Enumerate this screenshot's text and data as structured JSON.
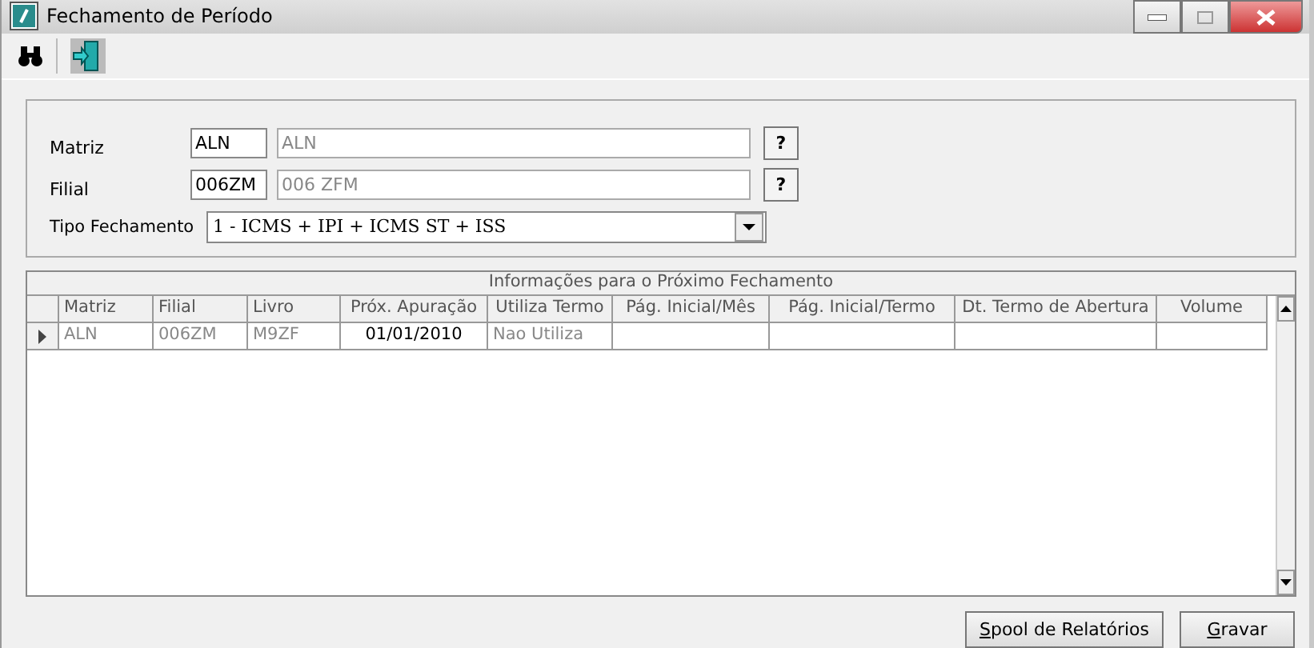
{
  "window": {
    "title": "Fechamento de Período"
  },
  "filters": {
    "matriz": {
      "label": "Matriz",
      "code": "ALN",
      "description": "ALN",
      "lookup": "?"
    },
    "filial": {
      "label": "Filial",
      "code": "006ZM",
      "description": "006 ZFM",
      "lookup": "?"
    },
    "tipo": {
      "label": "Tipo Fechamento",
      "value": "1  -  ICMS + IPI + ICMS ST + ISS"
    }
  },
  "table": {
    "title": "Informações para o Próximo Fechamento",
    "columns": [
      "Matriz",
      "Filial",
      "Livro",
      "Próx. Apuração",
      "Utiliza Termo",
      "Pág. Inicial/Mês",
      "Pág. Inicial/Termo",
      "Dt. Termo de Abertura",
      "Volume"
    ],
    "rows": [
      {
        "current": true,
        "cells": [
          "ALN",
          "006ZM",
          "M9ZF",
          "01/01/2010",
          "Nao Utiliza",
          "",
          "",
          "",
          ""
        ]
      }
    ]
  },
  "buttons": [
    "Spool de Relatórios",
    "Gravar"
  ]
}
